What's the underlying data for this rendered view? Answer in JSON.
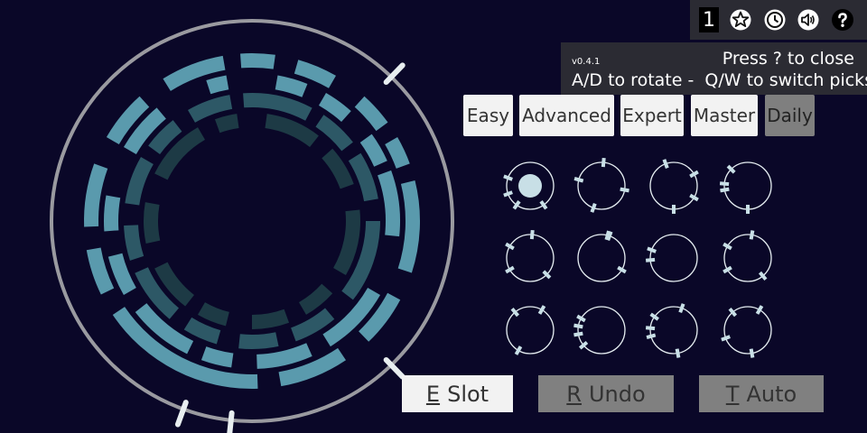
{
  "toolbar": {
    "level": "1",
    "icons": [
      "star-icon",
      "clock-icon",
      "speaker-icon",
      "help-icon"
    ]
  },
  "help": {
    "version": "v0.4.1",
    "close_hint": "Press ? to close",
    "controls": "A/D to rotate -  Q/W to switch picks"
  },
  "difficulty": {
    "options": [
      "Easy",
      "Advanced",
      "Expert",
      "Master",
      "Daily"
    ],
    "selected": "Daily"
  },
  "actions": [
    {
      "key": "E",
      "label": "Slot",
      "enabled": true
    },
    {
      "key": "R",
      "label": "Undo",
      "enabled": false
    },
    {
      "key": "T",
      "label": "Auto",
      "enabled": false
    }
  ],
  "colors": {
    "background": "#0a0728",
    "ring_bright": "#5a9aad",
    "ring_mid": "#2d5866",
    "ring_dark": "#1d3a45",
    "outer_ring": "#9a9aa0",
    "pick_marker": "#c8dfe6"
  },
  "lock": {
    "rings": [
      {
        "shade": "bright",
        "segments": [
          [
            -32,
            -10
          ],
          [
            -4,
            8
          ],
          [
            16,
            30
          ],
          [
            42,
            54
          ],
          [
            60,
            70
          ],
          [
            76,
            108
          ],
          [
            118,
            136
          ],
          [
            146,
            170
          ],
          [
            178,
            236
          ],
          [
            244,
            260
          ],
          [
            268,
            290
          ],
          [
            300,
            318
          ]
        ]
      },
      {
        "shade": "bright",
        "segments": [
          [
            -18,
            -10
          ],
          [
            10,
            22
          ],
          [
            30,
            42
          ],
          [
            54,
            66
          ],
          [
            70,
            96
          ],
          [
            120,
            148
          ],
          [
            156,
            178
          ],
          [
            188,
            200
          ],
          [
            206,
            232
          ],
          [
            240,
            256
          ],
          [
            266,
            280
          ],
          [
            300,
            320
          ]
        ]
      },
      {
        "shade": "mid",
        "segments": [
          [
            -30,
            -10
          ],
          [
            -4,
            28
          ],
          [
            34,
            52
          ],
          [
            58,
            80
          ],
          [
            90,
            128
          ],
          [
            140,
            160
          ],
          [
            168,
            186
          ],
          [
            196,
            212
          ],
          [
            220,
            246
          ],
          [
            252,
            268
          ],
          [
            278,
            300
          ],
          [
            306,
            322
          ]
        ]
      },
      {
        "shade": "dark",
        "segments": [
          [
            -20,
            -8
          ],
          [
            8,
            38
          ],
          [
            48,
            70
          ],
          [
            84,
            120
          ],
          [
            132,
            150
          ],
          [
            160,
            180
          ],
          [
            194,
            210
          ],
          [
            218,
            244
          ],
          [
            258,
            280
          ],
          [
            296,
            330
          ]
        ]
      }
    ],
    "notch_angles_deg": [
      200,
      186,
      136,
      44
    ]
  },
  "picks": [
    {
      "selected": true,
      "marks": [
        -70,
        250,
        215,
        145
      ]
    },
    {
      "selected": false,
      "marks": [
        -75,
        5,
        100,
        200
      ]
    },
    {
      "selected": false,
      "marks": [
        -20,
        60,
        120,
        180
      ]
    },
    {
      "selected": false,
      "marks": [
        -85,
        -100,
        -45,
        180
      ]
    },
    {
      "selected": false,
      "marks": [
        -60,
        5,
        135,
        240
      ]
    },
    {
      "selected": false,
      "marks": [
        120,
        15,
        20
      ]
    },
    {
      "selected": false,
      "marks": [
        -95,
        -70
      ]
    },
    {
      "selected": false,
      "marks": [
        -60,
        10,
        140,
        240
      ]
    },
    {
      "selected": false,
      "marks": [
        -40,
        30,
        210
      ]
    },
    {
      "selected": false,
      "marks": [
        -100,
        -80,
        -60,
        230
      ]
    },
    {
      "selected": false,
      "marks": [
        -105,
        -85,
        -55,
        20,
        170
      ]
    },
    {
      "selected": false,
      "marks": [
        -110,
        -40,
        30,
        170
      ]
    }
  ]
}
